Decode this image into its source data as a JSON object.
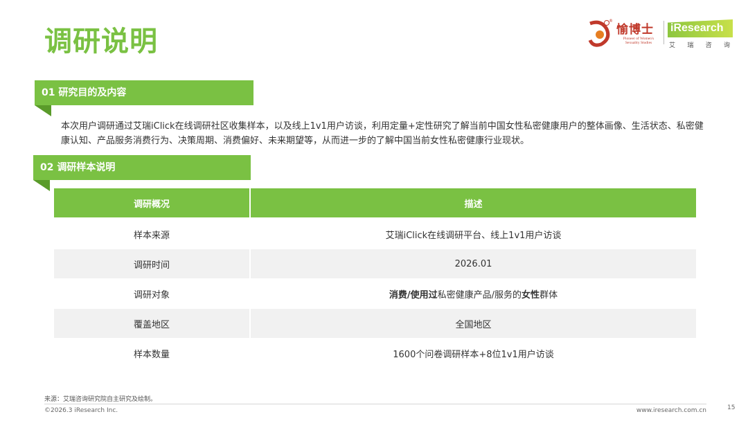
{
  "page": {
    "title": "调研说明",
    "colors": {
      "accent": "#7ac143",
      "accent_dark": "#5a9b2a",
      "alt_row": "#f1f1f1"
    }
  },
  "logos": {
    "partner": {
      "name": "愉博士",
      "registered": "®",
      "tagline": "Pioneer of Women's Sexuality Studies",
      "icon": "yu-boshi-logo"
    },
    "ir": {
      "name": "iResearch",
      "sub": [
        "艾",
        "瑞",
        "咨",
        "询"
      ]
    }
  },
  "section1": {
    "heading": "01 研究目的及内容",
    "body": "本次用户调研通过艾瑞iClick在线调研社区收集样本，以及线上1v1用户访谈，利用定量+定性研究了解当前中国女性私密健康用户的整体画像、生活状态、私密健康认知、产品服务消费行为、决策周期、消费偏好、未来期望等，从而进一步的了解中国当前女性私密健康行业现状。"
  },
  "section2": {
    "heading": "02 调研样本说明",
    "table": {
      "headers": [
        "调研概况",
        "描述"
      ],
      "rows": [
        {
          "label": "样本来源",
          "value": "艾瑞iClick在线调研平台、线上1v1用户访谈"
        },
        {
          "label": "调研时间",
          "value": "2026.01"
        },
        {
          "label": "调研对象",
          "value_parts": [
            {
              "text": "消费/使用过",
              "bold": true
            },
            {
              "text": "私密健康产品/服务的",
              "bold": false
            },
            {
              "text": "女性",
              "bold": true
            },
            {
              "text": "群体",
              "bold": false
            }
          ]
        },
        {
          "label": "覆盖地区",
          "value": "全国地区"
        },
        {
          "label": "样本数量",
          "value": "1600个问卷调研样本+8位1v1用户访谈"
        }
      ]
    }
  },
  "footer": {
    "source": "来源：艾瑞咨询研究院自主研究及绘制。",
    "copyright": "©2026.3 iResearch Inc.",
    "site": "www.iresearch.com.cn",
    "page_number": "15"
  }
}
